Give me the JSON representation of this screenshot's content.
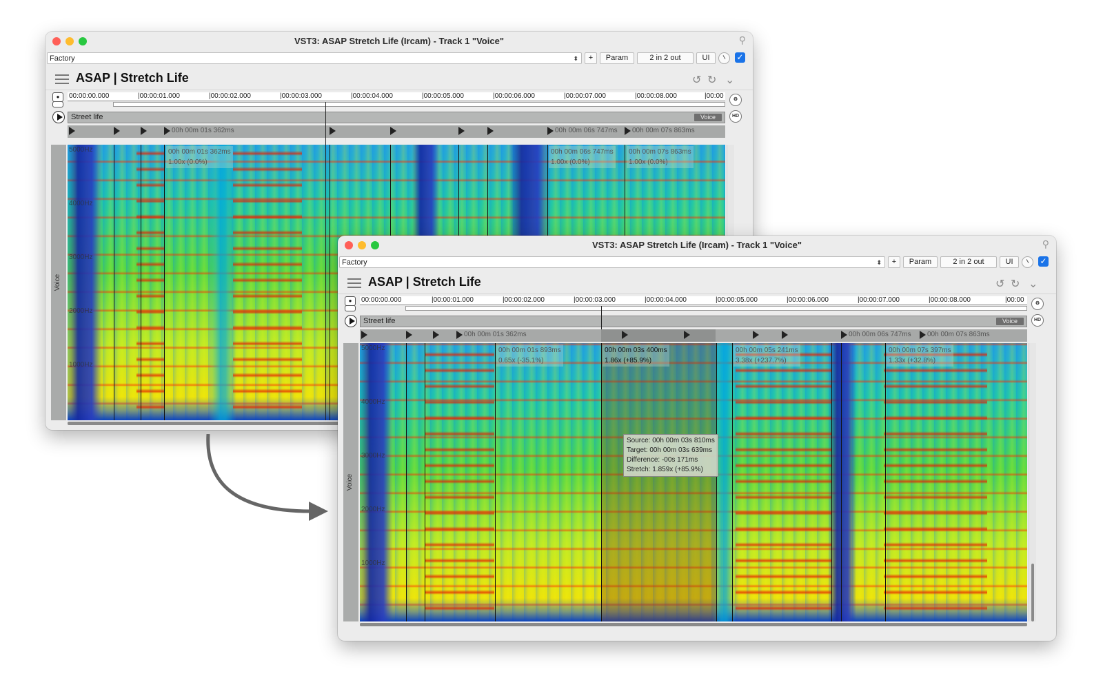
{
  "windows": [
    {
      "title": "VST3: ASAP Stretch Life (Ircam) - Track 1 \"Voice\"",
      "preset": "Factory",
      "buttons": {
        "add": "+",
        "param": "Param",
        "io": "2 in 2 out",
        "ui": "UI"
      },
      "plugin_title": "ASAP | Stretch Life",
      "hd": "HD",
      "ruler": [
        "00:00:00.000",
        "|00:00:01.000",
        "|00:00:02.000",
        "|00:00:03.000",
        "|00:00:04.000",
        "|00:00:05.000",
        "|00:00:06.000",
        "|00:00:07.000",
        "|00:00:08.000",
        "|00:00"
      ],
      "track_name": "Street life",
      "track_tag": "Voice",
      "side_label": "Voice",
      "freq_labels": [
        "5000Hz",
        "4000Hz",
        "3000Hz",
        "2000Hz",
        "1000Hz"
      ],
      "marker_labels": [
        "00h 00m 01s 362ms",
        "00h 00m 06s 747ms",
        "00h 00m 07s 863ms"
      ],
      "segments": [
        {
          "time": "00h 00m 01s 362ms",
          "ratio": "1.00x (0.0%)"
        },
        {
          "time": "00h 00m 06s 747ms",
          "ratio": "1.00x (0.0%)"
        },
        {
          "time": "00h 00m 07s 863ms",
          "ratio": "1.00x (0.0%)"
        }
      ]
    },
    {
      "title": "VST3: ASAP Stretch Life (Ircam) - Track 1 \"Voice\"",
      "preset": "Factory",
      "buttons": {
        "add": "+",
        "param": "Param",
        "io": "2 in 2 out",
        "ui": "UI"
      },
      "plugin_title": "ASAP | Stretch Life",
      "hd": "HD",
      "ruler": [
        "00:00:00.000",
        "|00:00:01.000",
        "|00:00:02.000",
        "|00:00:03.000",
        "|00:00:04.000",
        "|00:00:05.000",
        "|00:00:06.000",
        "|00:00:07.000",
        "|00:00:08.000",
        "|00:00"
      ],
      "track_name": "Street life",
      "track_tag": "Voice",
      "side_label": "Voice",
      "freq_labels": [
        "5000Hz",
        "4000Hz",
        "3000Hz",
        "2000Hz",
        "1000Hz"
      ],
      "marker_labels": [
        "00h 00m 01s 362ms",
        "00h 00m 06s 747ms",
        "00h 00m 07s 863ms"
      ],
      "segments": [
        {
          "time": "00h 00m 01s 893ms",
          "ratio": "0.65x (-35.1%)"
        },
        {
          "time": "00h 00m 03s 400ms",
          "ratio": "1.86x (+85.9%)"
        },
        {
          "time": "00h 00m 05s 241ms",
          "ratio": "3.38x (+237.7%)"
        },
        {
          "time": "00h 00m 07s 397ms",
          "ratio": "1.33x (+32.8%)"
        }
      ],
      "tooltip": {
        "source": "Source: 00h 00m 03s 810ms",
        "target": "Target: 00h 00m 03s 639ms",
        "difference": "Difference: -00s 171ms",
        "stretch": "Stretch: 1.859x (+85.9%)"
      }
    }
  ],
  "colors": {
    "accent": "#1a73e8",
    "close": "#ff5f57",
    "minimize": "#febc2e",
    "zoom": "#28c840"
  },
  "icons": [
    "menu-icon",
    "undo-icon",
    "redo-icon",
    "chevron-down-icon",
    "pin-icon",
    "play-icon",
    "record-icon",
    "loop-icon",
    "curved-arrow-icon"
  ]
}
